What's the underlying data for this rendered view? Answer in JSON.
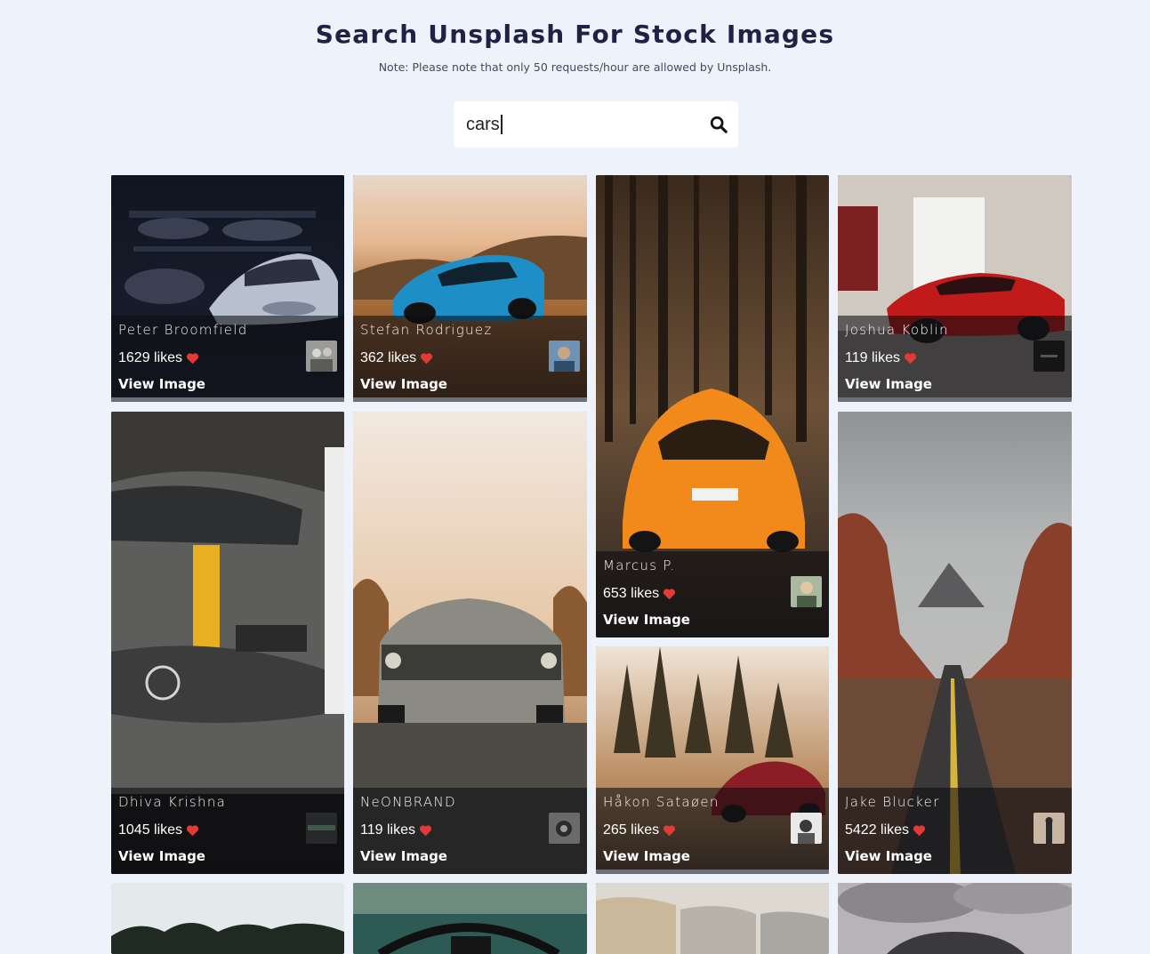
{
  "header": {
    "title": "Search Unsplash For Stock Images",
    "note": "Note: Please note that only 50 requests/hour are allowed by Unsplash."
  },
  "search": {
    "value": "cars",
    "placeholder": ""
  },
  "cards": [
    {
      "author": "Peter Broomfield",
      "likes": "1629 likes",
      "view": "View Image"
    },
    {
      "author": "Stefan Rodriguez",
      "likes": "362 likes",
      "view": "View Image"
    },
    {
      "author": "Marcus P.",
      "likes": "653 likes",
      "view": "View Image"
    },
    {
      "author": "Joshua Koblin",
      "likes": "119 likes",
      "view": "View Image"
    },
    {
      "author": "Dhiva Krishna",
      "likes": "1045 likes",
      "view": "View Image"
    },
    {
      "author": "NeONBRAND",
      "likes": "119 likes",
      "view": "View Image"
    },
    {
      "author": "Håkon Sataøen",
      "likes": "265 likes",
      "view": "View Image"
    },
    {
      "author": "Jake Blucker",
      "likes": "5422 likes",
      "view": "View Image"
    }
  ],
  "colors": {
    "background": "#eef2fb",
    "heart": "#e53935",
    "title": "#1e2244"
  },
  "icons": {
    "search": "search-icon",
    "heart": "heart-icon"
  }
}
